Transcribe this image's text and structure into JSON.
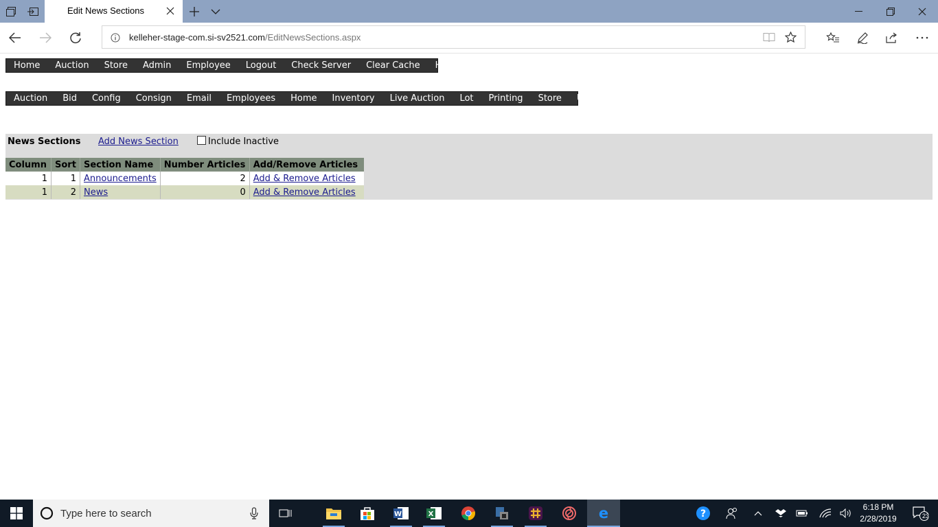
{
  "browser": {
    "tab_title": "Edit News Sections",
    "url_host": "kelleher-stage-com.si-sv2521.com",
    "url_path": "/EditNewsSections.aspx"
  },
  "top_menu": [
    "Home",
    "Auction",
    "Store",
    "Admin",
    "Employee",
    "Logout",
    "Check Server",
    "Clear Cache",
    "Help"
  ],
  "sub_menu": [
    "Auction",
    "Bid",
    "Config",
    "Consign",
    "Email",
    "Employees",
    "Home",
    "Inventory",
    "Live Auction",
    "Lot",
    "Printing",
    "Store",
    "Users"
  ],
  "section": {
    "title": "News Sections",
    "add_link": "Add News Section",
    "include_inactive_label": "Include Inactive",
    "include_inactive_checked": false
  },
  "table": {
    "headers": [
      "Column",
      "Sort",
      "Section Name",
      "Number Articles",
      "Add/Remove Articles"
    ],
    "rows": [
      {
        "column": "1",
        "sort": "1",
        "name": "Announcements",
        "articles": "2",
        "action": "Add & Remove Articles"
      },
      {
        "column": "1",
        "sort": "2",
        "name": "News",
        "articles": "0",
        "action": "Add & Remove Articles"
      }
    ]
  },
  "taskbar": {
    "search_placeholder": "Type here to search",
    "time": "6:18 PM",
    "date": "2/28/2019",
    "notification_count": "23"
  },
  "colors": {
    "menu_bg": "#333333",
    "header_bg": "#7f8d7d",
    "alt_row_bg": "#d7dcc1",
    "band_bg": "#dcdcdc",
    "link": "#1a1a8e"
  }
}
